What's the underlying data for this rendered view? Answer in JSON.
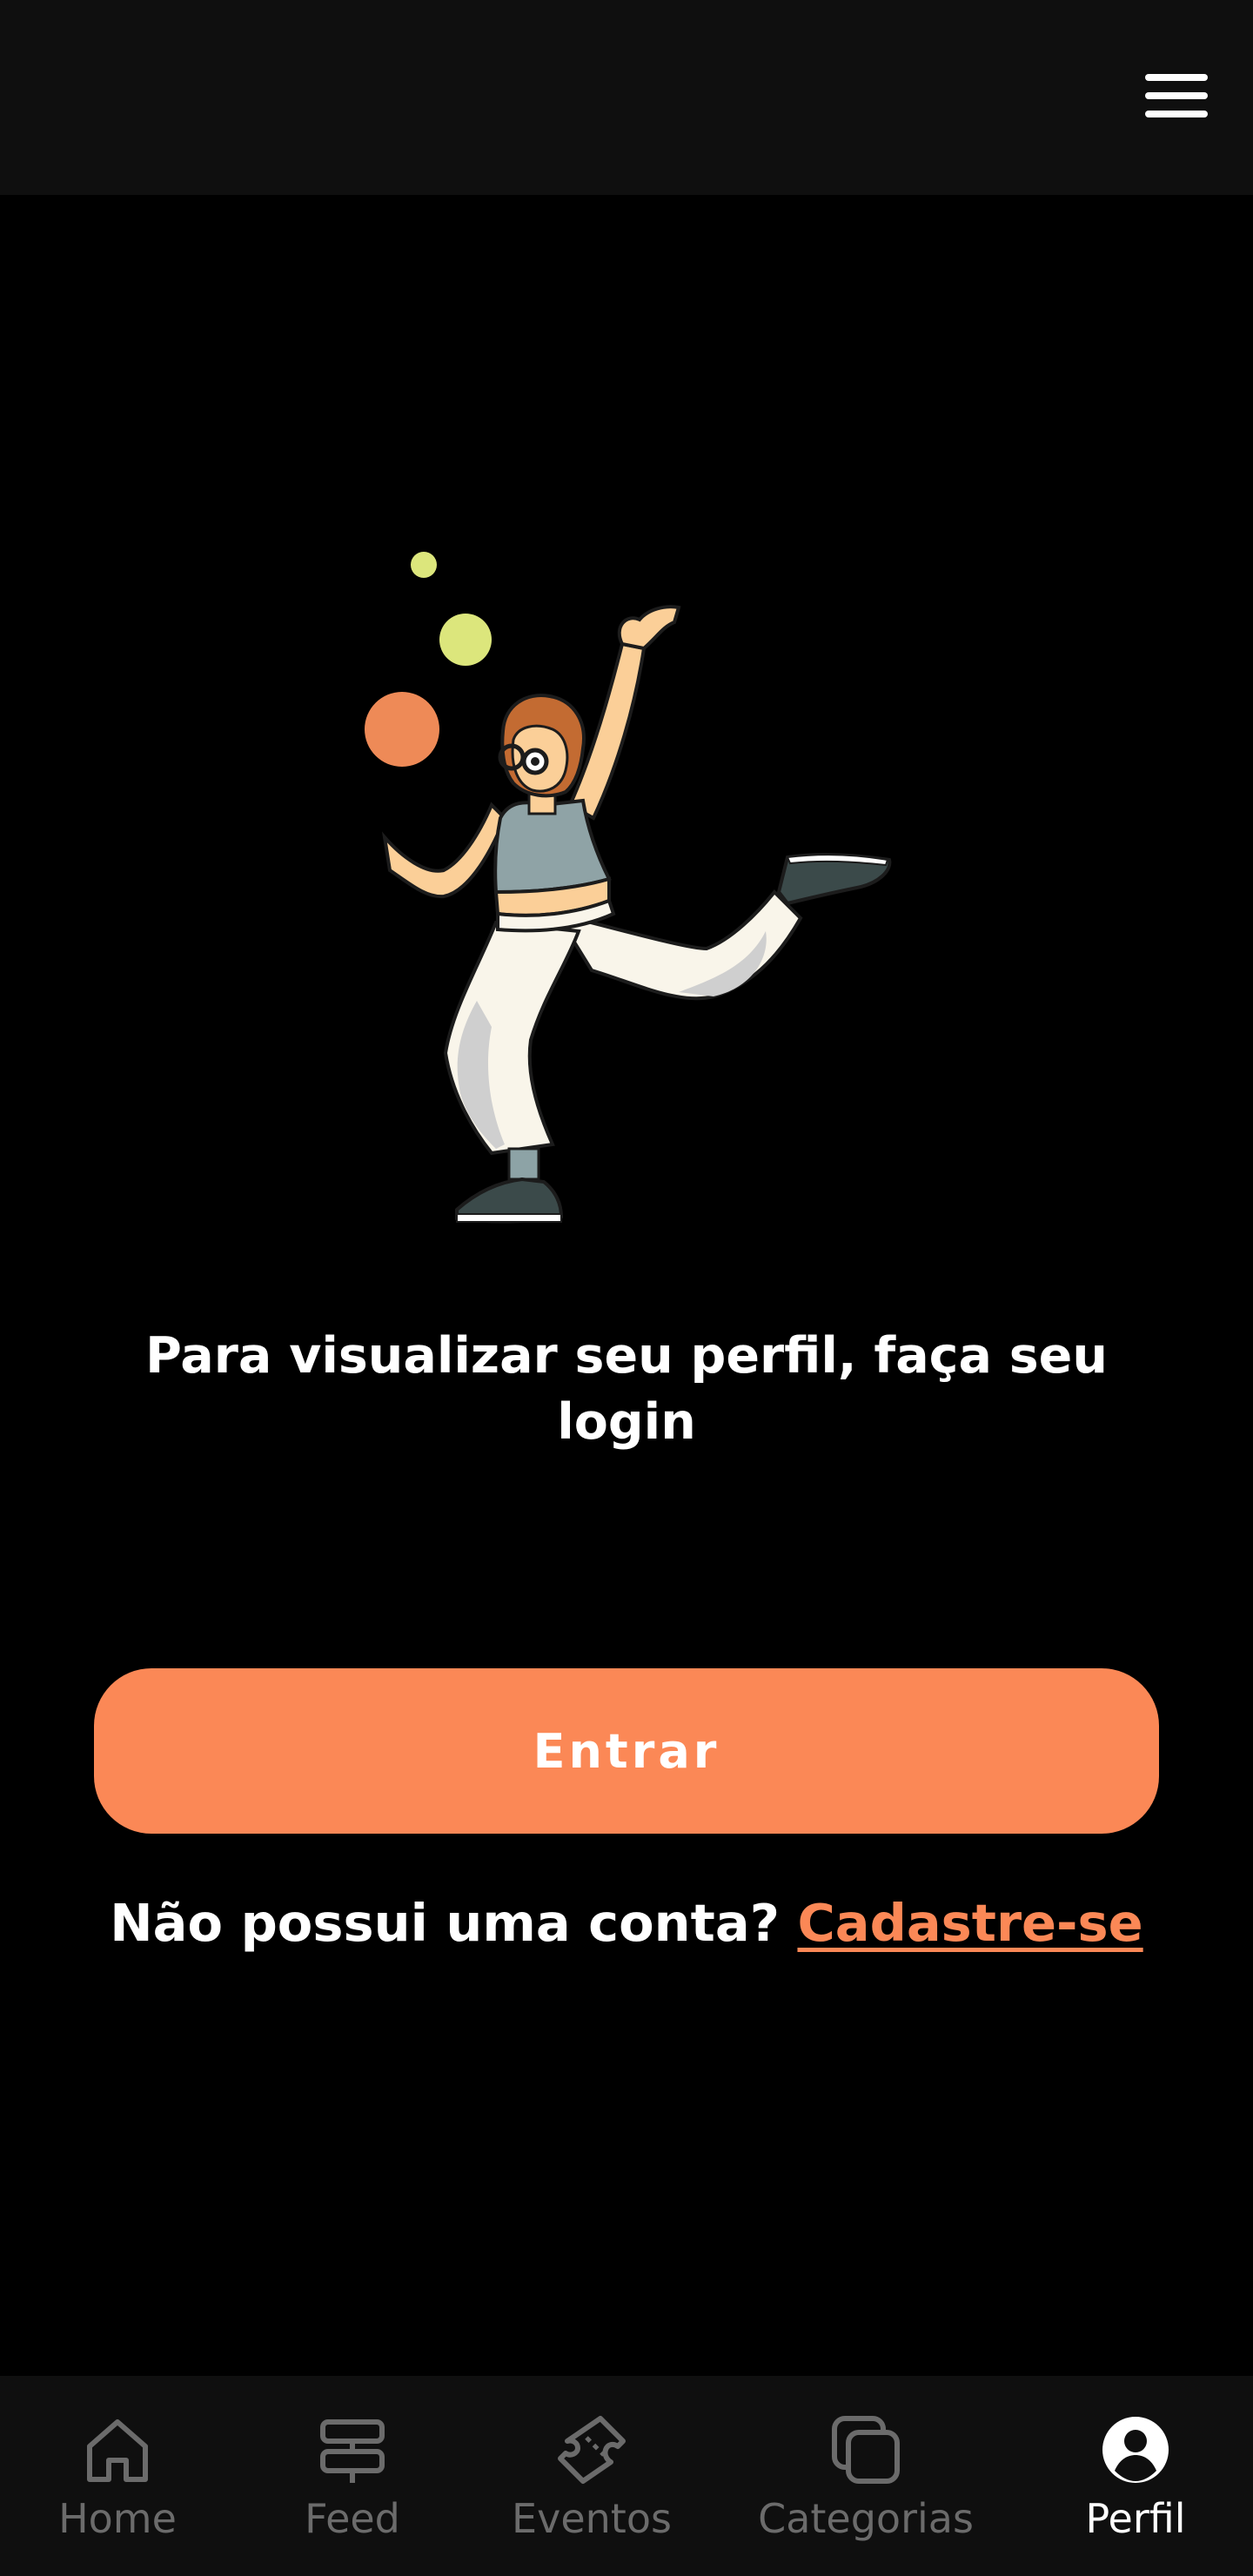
{
  "header": {
    "menu_icon": "hamburger-menu-icon"
  },
  "main": {
    "illustration": "juggling-woman-illustration",
    "prompt_text": "Para visualizar seu perfil, faça seu login",
    "login_button_label": "Entrar",
    "signup_question": "Não possui uma conta?",
    "signup_link_label": "Cadastre-se"
  },
  "bottom_nav": {
    "items": [
      {
        "label": "Home",
        "icon": "home-icon"
      },
      {
        "label": "Feed",
        "icon": "signpost-icon"
      },
      {
        "label": "Eventos",
        "icon": "ticket-icon"
      },
      {
        "label": "Categorias",
        "icon": "categories-icon"
      },
      {
        "label": "Perfil",
        "icon": "profile-icon"
      }
    ],
    "active_label": "Perfil"
  },
  "colors": {
    "background": "#000000",
    "bars": "#0f0f0f",
    "accent": "#fb8856",
    "text": "#ffffff",
    "inactive": "#6b6b6b"
  }
}
